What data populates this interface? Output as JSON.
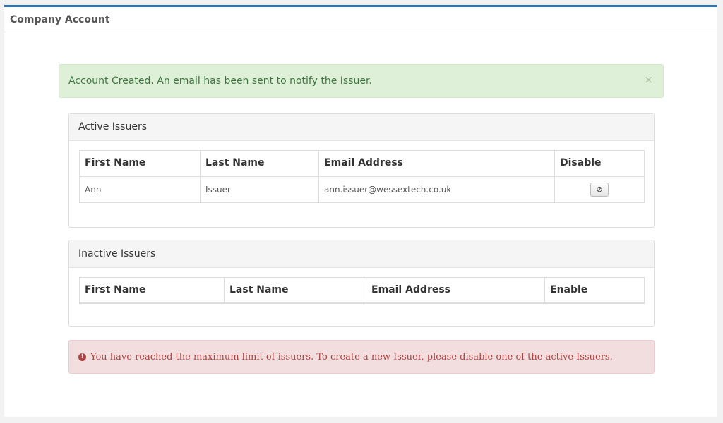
{
  "page": {
    "title": "Company Account"
  },
  "alerts": {
    "success": {
      "message": "Account Created. An email has been sent to notify the Issuer.",
      "close_icon": "×"
    },
    "danger": {
      "icon": "!",
      "message": "You have reached the maximum limit of issuers. To create a new Issuer, please disable one of the active Issuers."
    }
  },
  "active_issuers": {
    "heading": "Active Issuers",
    "columns": [
      "First Name",
      "Last Name",
      "Email Address",
      "Disable"
    ],
    "rows": [
      {
        "first_name": "Ann",
        "last_name": "Issuer",
        "email": "ann.issuer@wessextech.co.uk",
        "action_icon": "⊘"
      }
    ]
  },
  "inactive_issuers": {
    "heading": "Inactive Issuers",
    "columns": [
      "First Name",
      "Last Name",
      "Email Address",
      "Enable"
    ]
  },
  "colors": {
    "accent": "#2d72b0",
    "success_bg": "#dff0d8",
    "success_text": "#3c763d",
    "danger_bg": "#f2dede",
    "danger_text": "#a94442"
  }
}
